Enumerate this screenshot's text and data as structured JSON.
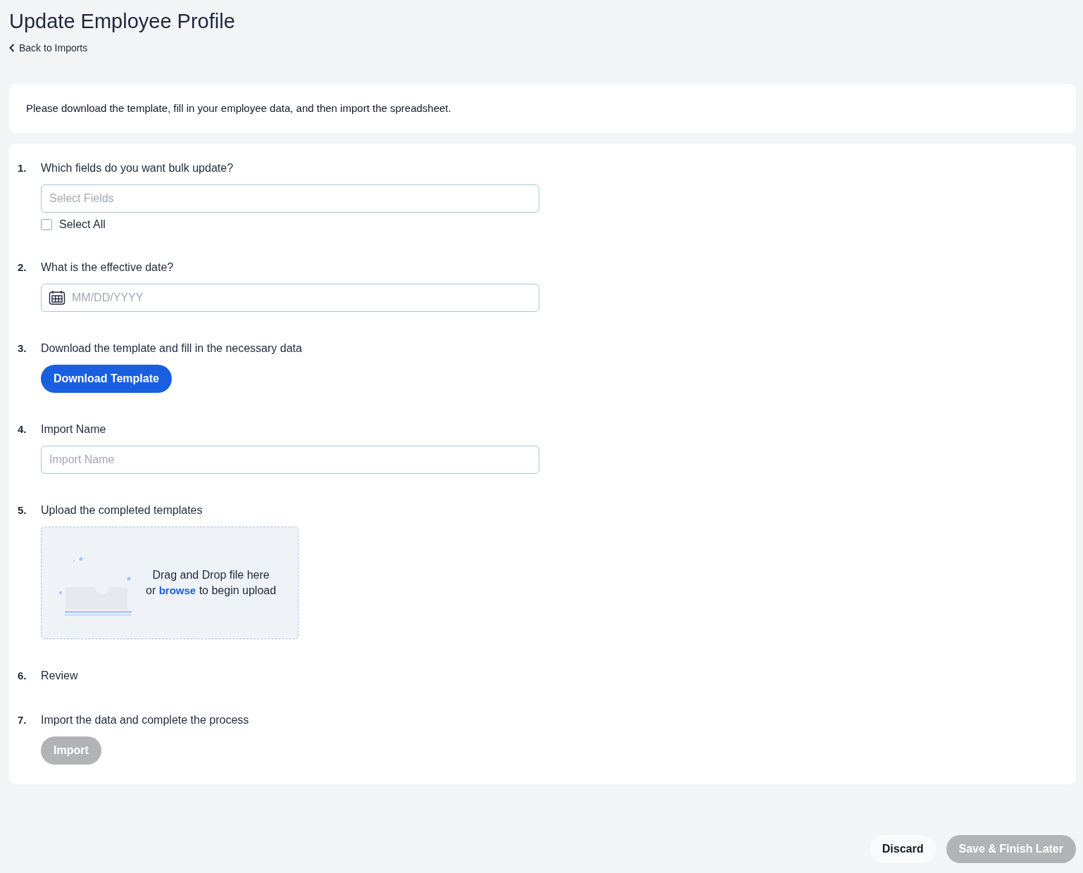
{
  "title": "Update Employee Profile",
  "back_link": "Back to Imports",
  "notice": "Please download the template, fill in your employee data, and then import the spreadsheet.",
  "steps": [
    {
      "number": "1.",
      "kind": "select",
      "question": "Which fields do you want bulk update?",
      "placeholder": "Select Fields",
      "checkbox": {
        "label": "Select All",
        "checked": false
      }
    },
    {
      "number": "2.",
      "kind": "date",
      "question": "What is the effective date?",
      "placeholder": "MM/DD/YYYY"
    },
    {
      "number": "3.",
      "kind": "button",
      "question": "Download the template and fill in the necessary data",
      "button": {
        "label": "Download Template",
        "disabled": false
      }
    },
    {
      "number": "4.",
      "kind": "text",
      "question": "Import Name",
      "placeholder": "Import Name"
    },
    {
      "number": "5.",
      "kind": "upload",
      "question": "Upload the completed templates",
      "upload": {
        "line1": "Drag and Drop file here",
        "prefix": "or",
        "link": "browse",
        "suffix": "to begin upload"
      }
    },
    {
      "number": "6.",
      "kind": "plain",
      "question": "Review"
    },
    {
      "number": "7.",
      "kind": "button",
      "question": "Import the data and complete the process",
      "button": {
        "label": "Import",
        "disabled": true
      }
    }
  ],
  "footer": [
    {
      "label": "Discard",
      "kind": "secondary",
      "disabled": false
    },
    {
      "label": "Save & Finish Later",
      "kind": "primary",
      "disabled": true
    }
  ]
}
